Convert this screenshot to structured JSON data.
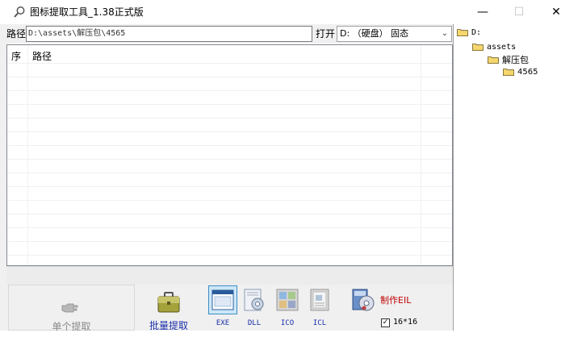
{
  "window": {
    "title": "图标提取工具_1.38正式版",
    "min_glyph": "—",
    "max_glyph": "☐",
    "close_glyph": "✕"
  },
  "pathbar": {
    "path_label": "路径",
    "path_value": "D:\\assets\\解压包\\4565",
    "open_label": "打开",
    "drive_value": "D: （硬盘） 固态",
    "dropdown_icon": "chevron-down-icon"
  },
  "list": {
    "columns": [
      "序",
      "路径"
    ],
    "rows": []
  },
  "tree": {
    "nodes": [
      {
        "label": "D:",
        "depth": 0
      },
      {
        "label": "assets",
        "depth": 1
      },
      {
        "label": "解压包",
        "depth": 2
      },
      {
        "label": "4565",
        "depth": 3
      }
    ]
  },
  "toolbar": {
    "single_extract_label": "单个提取",
    "batch_extract_label": "批量提取",
    "file_types": [
      {
        "label": "EXE",
        "selected": true
      },
      {
        "label": "DLL",
        "selected": false
      },
      {
        "label": "ICO",
        "selected": false
      },
      {
        "label": "ICL",
        "selected": false
      }
    ],
    "make_label": "制作EIL",
    "size_label": "16*16",
    "size_checked": true
  },
  "colors": {
    "folder": "#f5d76e",
    "accent_blue": "#1a2ea8",
    "make_red": "#c00000"
  }
}
